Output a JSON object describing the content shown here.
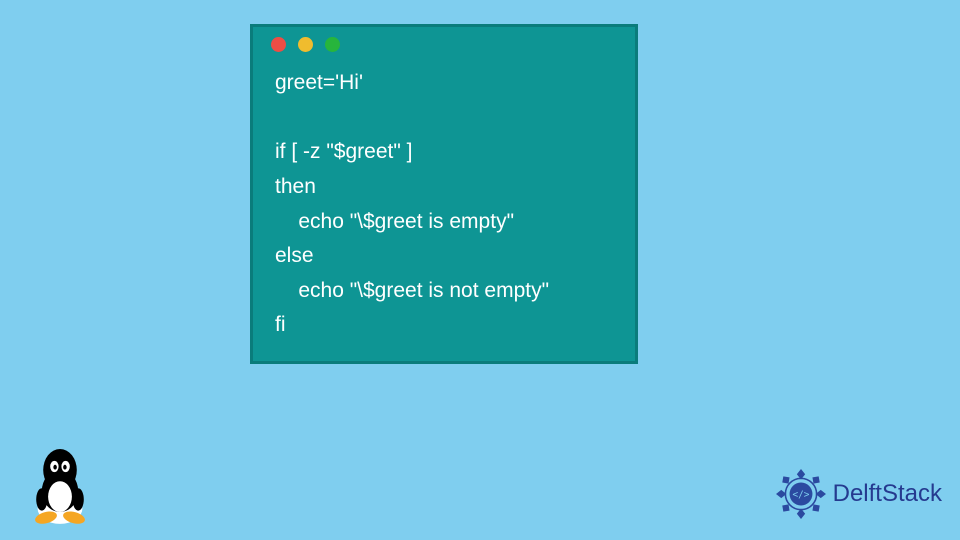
{
  "code": {
    "line1": "greet='Hi'",
    "line2": "",
    "line3": "if [ -z \"$greet\" ]",
    "line4": "then",
    "line5": "    echo \"\\$greet is empty\"",
    "line6": "else",
    "line7": "    echo \"\\$greet is not empty\"",
    "line8": "fi"
  },
  "branding": {
    "label": "DelftStack"
  },
  "colors": {
    "background": "#7fceef",
    "window": "#0e9594",
    "brand": "#253a8f"
  }
}
